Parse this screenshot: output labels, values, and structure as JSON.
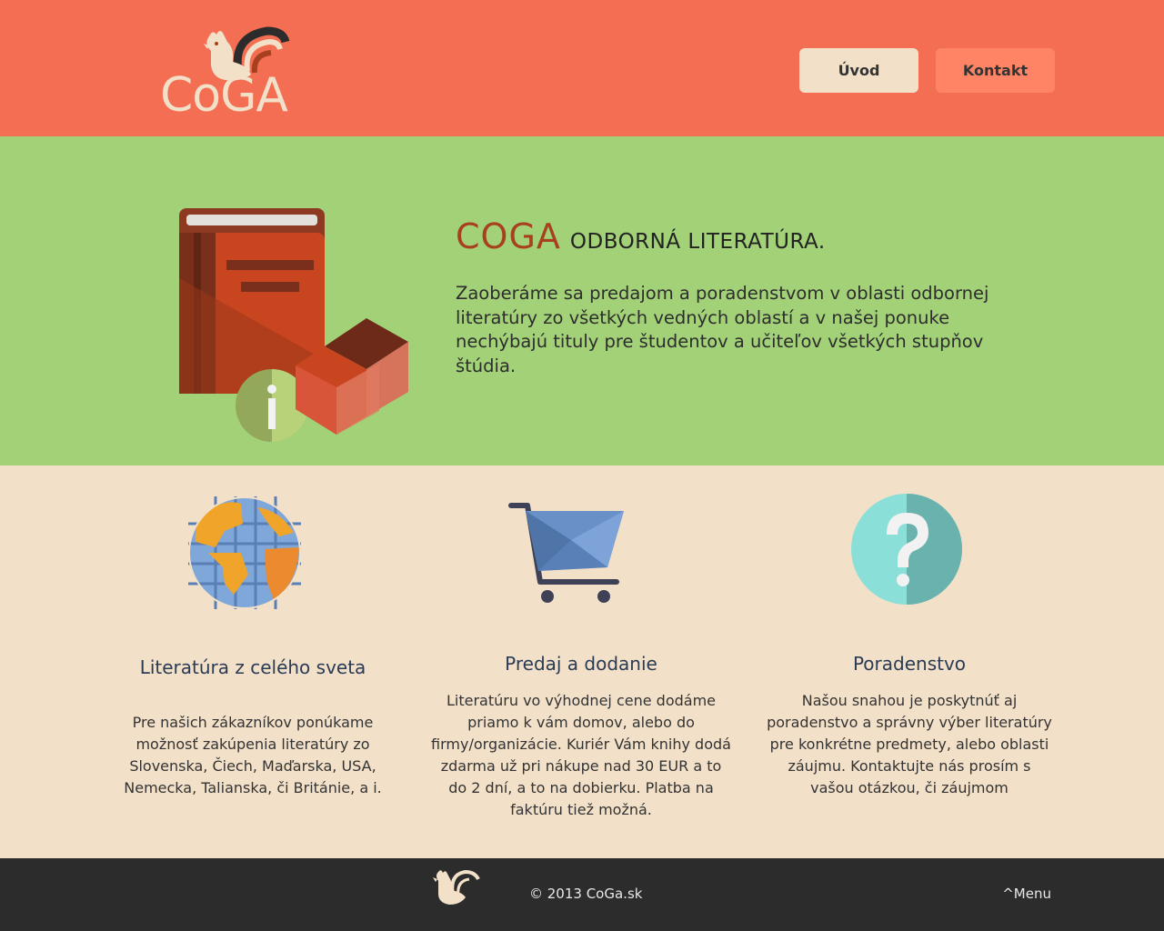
{
  "header": {
    "logo_text": "CoGA",
    "nav": {
      "uvod_label": "Úvod",
      "kontakt_label": "Kontakt"
    }
  },
  "hero": {
    "brand": "COGA",
    "subtitle": "ODBORNÁ LITERATÚRA.",
    "text": "Zaoberáme sa predajom a poradenstvom v oblasti odbornej literatúry zo všetkých vedných oblastí a v našej ponuke nechýbajú tituly pre študentov a učiteľov všetkých stupňov štúdia."
  },
  "features": [
    {
      "icon": "globe-icon",
      "title": "Literatúra z celého sveta",
      "text": "Pre našich zákazníkov ponúkame možnosť zakúpenia literatúry zo Slovenska, Čiech, Maďarska, USA, Nemecka, Talianska, či Británie, a i."
    },
    {
      "icon": "shopping-cart-icon",
      "title": "Predaj a dodanie",
      "text": "Literatúru vo výhodnej cene dodáme priamo k vám domov, alebo do firmy/organizácie. Kuriér Vám knihy dodá zdarma už pri nákupe nad 30 EUR a to do 2 dní, a to na dobierku. Platba na faktúru tiež možná."
    },
    {
      "icon": "question-mark-icon",
      "title": "Poradenstvo",
      "text": "Našou snahou je poskytnúť aj poradenstvo a správny výber literatúry pre konkrétne predmety, alebo oblasti záujmu. Kontaktujte nás prosím s vašou otázkou, či záujmom"
    }
  ],
  "footer": {
    "copyright": "© 2013 CoGa.sk",
    "menu_link": "^Menu"
  },
  "colors": {
    "header_bg": "#F36E52",
    "hero_bg": "#A2D177",
    "features_bg": "#F2E0C8",
    "footer_bg": "#2C2C2C",
    "brand_text": "#A7401F"
  }
}
